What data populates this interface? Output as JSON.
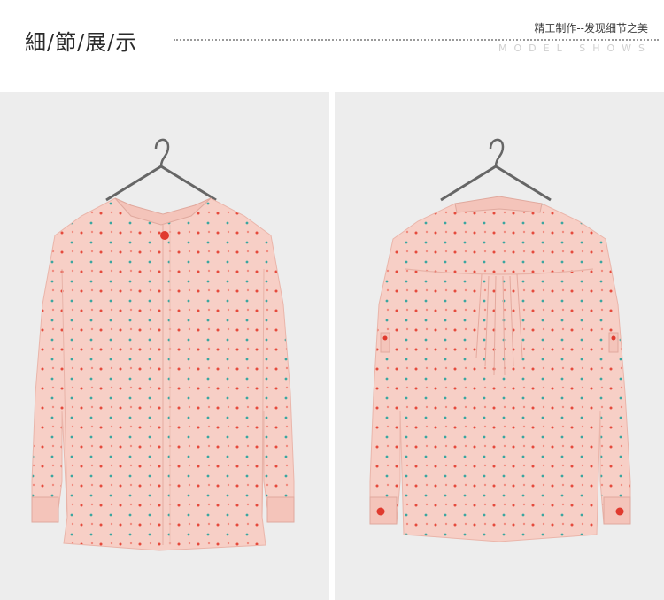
{
  "header": {
    "title": "細/節/展/示",
    "subtitle_cn": "精工制作--发现细节之美",
    "subtitle_en": "MODEL SHOWS"
  },
  "panels": [
    {
      "view": "front",
      "shirt_color": "#f7cfc6",
      "button_color": "#e03a2e"
    },
    {
      "view": "back",
      "shirt_color": "#f7cfc6",
      "button_color": "#e03a2e"
    }
  ],
  "colors": {
    "background_panel": "#ededed",
    "dot_red": "#e54a3c",
    "dot_teal": "#3aa6a0"
  }
}
